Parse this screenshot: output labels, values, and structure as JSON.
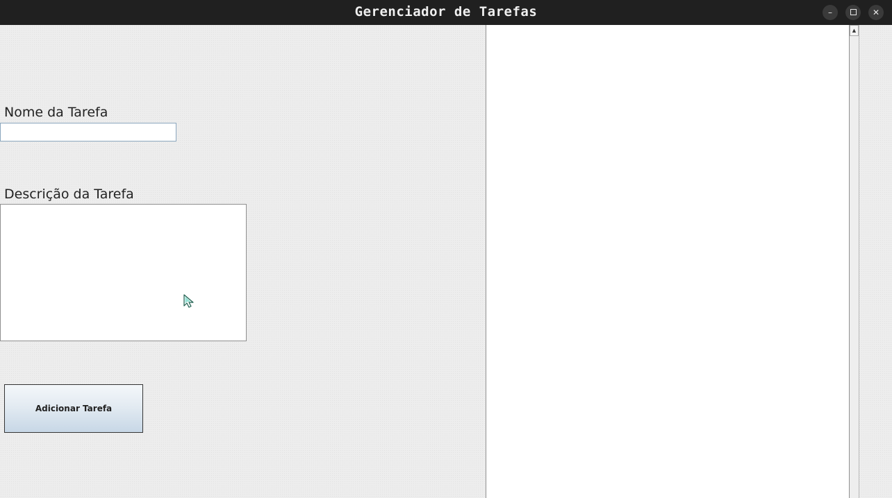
{
  "window": {
    "title": "Gerenciador de Tarefas",
    "controls": {
      "minimize": "–",
      "close": "✕"
    }
  },
  "form": {
    "name_label": "Nome da Tarefa",
    "name_value": "",
    "description_label": "Descrição da Tarefa",
    "description_value": "",
    "add_button_label": "Adicionar Tarefa"
  },
  "task_list": {
    "items": []
  },
  "icons": {
    "cursor": "pointer-cursor-icon",
    "scroll_up": "scroll-up-arrow-icon"
  },
  "colors": {
    "titlebar": "#202020",
    "button_gradient_bottom": "#c7d7e6",
    "input_border": "#8aa6bd"
  }
}
